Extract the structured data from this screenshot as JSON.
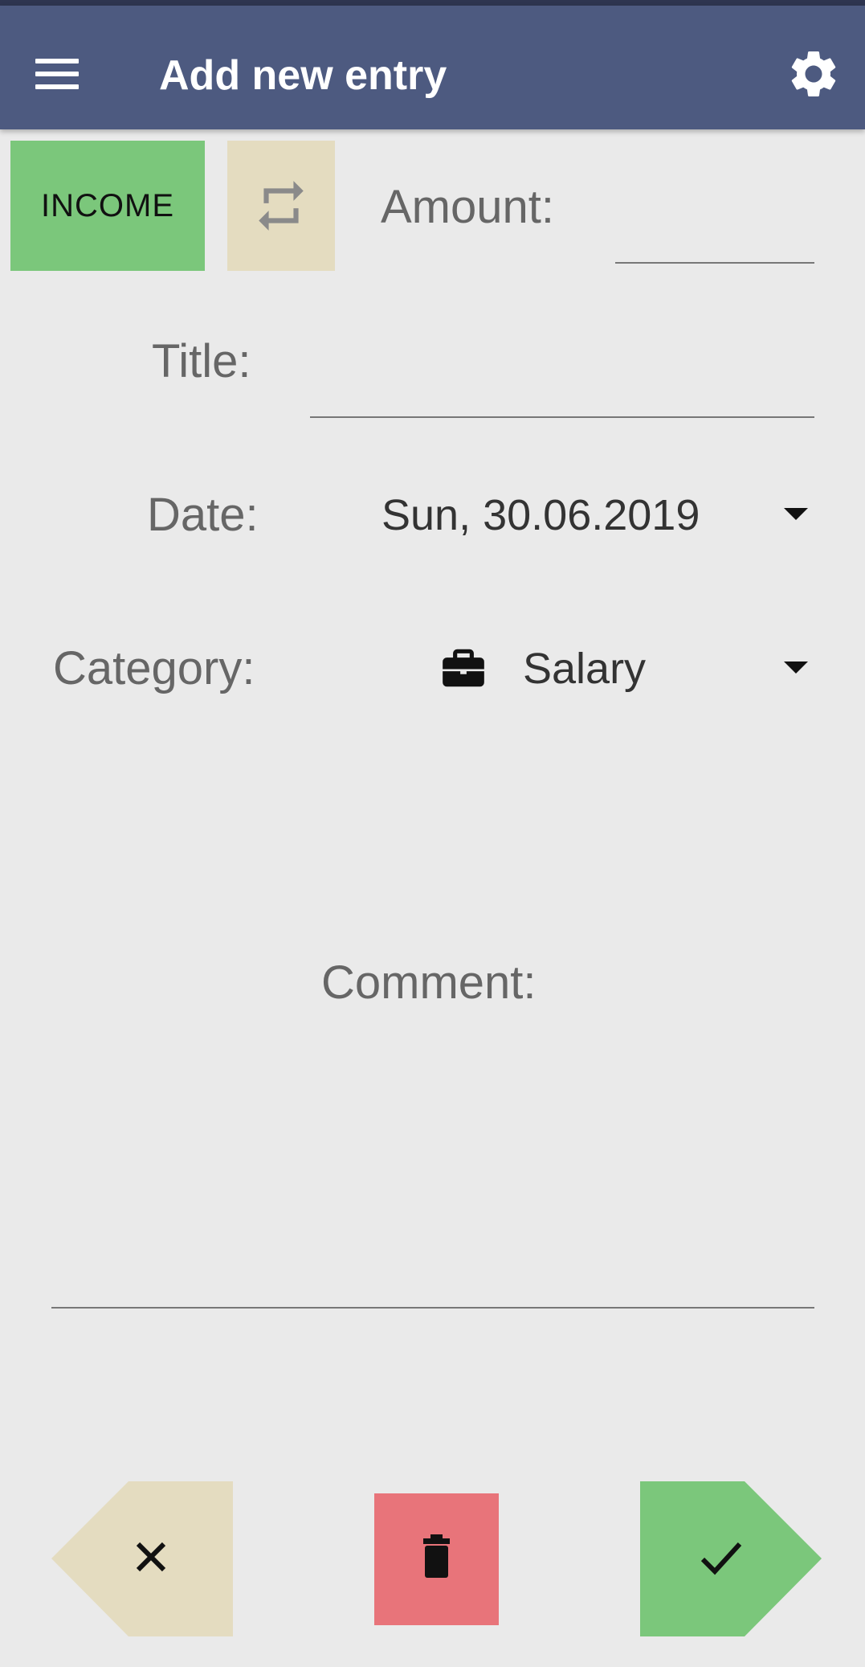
{
  "app_bar": {
    "title": "Add new entry",
    "menu_icon": "hamburger-menu-icon",
    "settings_icon": "gear-icon",
    "color": "#4d5a80"
  },
  "entry_type": {
    "label": "INCOME",
    "color": "#7bc77b",
    "repeat_icon": "repeat-icon",
    "repeat_color": "#e4dcc0"
  },
  "form": {
    "amount_label": "Amount:",
    "amount_value": "",
    "title_label": "Title:",
    "title_value": "",
    "date_label": "Date:",
    "date_value": "Sun, 30.06.2019",
    "category_label": "Category:",
    "category_value": "Salary",
    "category_icon": "briefcase-icon",
    "comment_label": "Comment:",
    "comment_value": ""
  },
  "actions": {
    "cancel_icon": "close-icon",
    "cancel_color": "#e4dcc0",
    "delete_icon": "trash-icon",
    "delete_color": "#e8747a",
    "confirm_icon": "checkmark-icon",
    "confirm_color": "#7bc77b"
  }
}
